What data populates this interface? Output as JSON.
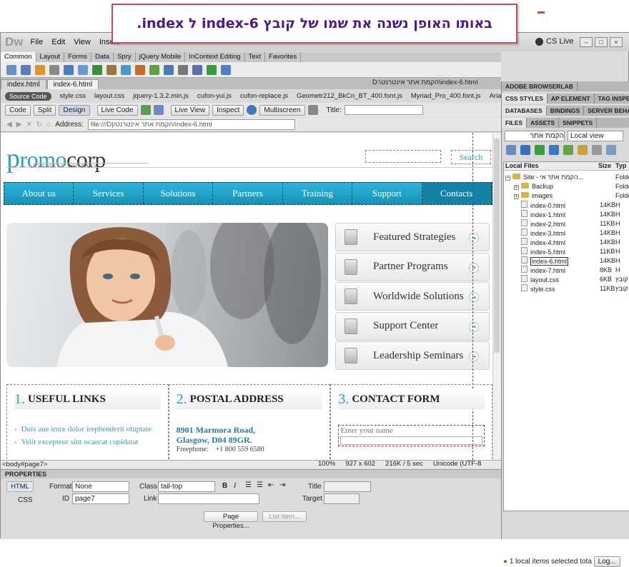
{
  "callout": {
    "text": "באותו האופן נשנה את שמו של קובץ index-6 ל index."
  },
  "app": {
    "logo": "Dw",
    "menu": [
      "File",
      "Edit",
      "View",
      "Insert"
    ],
    "cs_live": "CS Live",
    "window_buttons": [
      "–",
      "□",
      "×"
    ]
  },
  "insert_tabs": [
    "Common",
    "Layout",
    "Forms",
    "Data",
    "Spry",
    "jQuery Mobile",
    "InContext Editing",
    "Text",
    "Favorites"
  ],
  "doc_tabs": [
    "index.html",
    "index-6.html"
  ],
  "doc_path": "D:\\הקמת אתר אינטרנט\\index-6.html",
  "related_files": {
    "source": "Source Code",
    "files": [
      "style.css",
      "layout.css",
      "jquery-1.3.2.min.js",
      "cufon-yui.js",
      "cufon-replace.js",
      "Geometr212_BkCn_BT_400.font.js",
      "Myriad_Pro_400.font.js",
      "Arial_Narrow"
    ]
  },
  "doc_toolbar": {
    "code": "Code",
    "split": "Split",
    "design": "Design",
    "live_code": "Live Code",
    "live_view": "Live View",
    "inspect": "Inspect",
    "multiscreen": "Multiscreen",
    "title_label": "Title:"
  },
  "address": {
    "label": "Address:",
    "value": "file:///D|/הקמת אתר אינטרנט/index-6.html"
  },
  "site": {
    "logo_p": "p",
    "logo_rest1": "romo",
    "logo_mid": "corp",
    "logo_sub": "business company",
    "search": "Search",
    "nav": [
      "About us",
      "Services",
      "Solutions",
      "Partners",
      "Training",
      "Support",
      "Contacts"
    ],
    "features": [
      "Featured Strategies",
      "Partner Programs",
      "Worldwide Solutions",
      "Support Center",
      "Leadership Seminars"
    ],
    "col1": {
      "num": "1.",
      "title": "USEFUL LINKS",
      "links": [
        "Duis aue irure dolor irephenderit oluptate",
        "Velit excepteur sint ocaecat cupidatat"
      ]
    },
    "col2": {
      "num": "2.",
      "title": "POSTAL ADDRESS",
      "line1": "8901 Marmora Road,",
      "line2": "Glasgow, D04 89GR.",
      "phone_label": "Freephone:",
      "phone": "+1 800 559 6580"
    },
    "col3": {
      "num": "3.",
      "title": "CONTACT FORM",
      "placeholder": "Enter your name"
    }
  },
  "statusbar": {
    "tag": "<body#page7>",
    "zoom": "100%",
    "size": "927 x 602",
    "weight": "216K / 5 sec",
    "encoding": "Unicode (UTF-8"
  },
  "properties": {
    "header": "PROPERTIES",
    "html": "HTML",
    "css": "CSS",
    "format_label": "Format",
    "format": "None",
    "class_label": "Class",
    "class": "tail-top",
    "id_label": "ID",
    "id": "page7",
    "link_label": "Link",
    "title_label": "Title",
    "target_label": "Target",
    "page_props": "Page Properties...",
    "list_item": "List Item..."
  },
  "panel": {
    "browserlab": "ADOBE BROWSERLAB",
    "tabs1": [
      "CSS STYLES",
      "AP ELEMENT",
      "TAG INSPEC"
    ],
    "tabs2": [
      "DATABASES",
      "BINDINGS",
      "SERVER BEHA"
    ],
    "tabs3": [
      "FILES",
      "ASSETS",
      "SNIPPETS"
    ],
    "site_select": "הקמת אתר",
    "view_select": "Local view",
    "col_name": "Local Files",
    "col_size": "Size",
    "col_type": "Typ",
    "files": [
      {
        "name": "Site - הקמת אתר אי...",
        "size": "",
        "type": "Folde",
        "kind": "root"
      },
      {
        "name": "Backup",
        "size": "",
        "type": "Folde",
        "kind": "folder"
      },
      {
        "name": "images",
        "size": "",
        "type": "Folde",
        "kind": "folder"
      },
      {
        "name": "index-0.html",
        "size": "14KB",
        "type": "H",
        "kind": "file"
      },
      {
        "name": "index-1.html",
        "size": "14KB",
        "type": "H",
        "kind": "file"
      },
      {
        "name": "index-2.html",
        "size": "11KB",
        "type": "H",
        "kind": "file"
      },
      {
        "name": "index-3.html",
        "size": "14KB",
        "type": "H",
        "kind": "file"
      },
      {
        "name": "index-4.html",
        "size": "14KB",
        "type": "H",
        "kind": "file"
      },
      {
        "name": "index-5.html",
        "size": "11KB",
        "type": "H",
        "kind": "file"
      },
      {
        "name": "index-6.html",
        "size": "14KB",
        "type": "H",
        "kind": "editing"
      },
      {
        "name": "index-7.html",
        "size": "8KB",
        "type": "H",
        "kind": "file"
      },
      {
        "name": "layout.css",
        "size": "6KB",
        "type": "קובץ",
        "kind": "file"
      },
      {
        "name": "style.css",
        "size": "11KB",
        "type": "קובץ",
        "kind": "file"
      }
    ],
    "status": "1 local items selected tota",
    "log": "Log..."
  }
}
